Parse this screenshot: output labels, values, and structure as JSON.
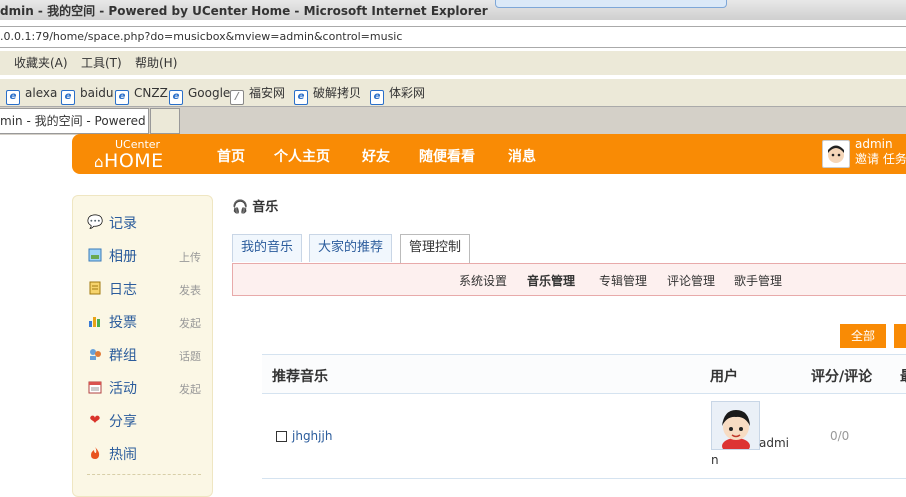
{
  "window": {
    "title": "dmin - 我的空间 - Powered by UCenter Home - Microsoft Internet Explorer",
    "address": ".0.0.1:79/home/space.php?do=musicbox&mview=admin&control=music"
  },
  "menu": [
    "收藏夹(A)",
    "工具(T)",
    "帮助(H)"
  ],
  "favorites": [
    "alexa",
    "baidu",
    "CNZZ",
    "Google",
    "福安网",
    "破解拷贝",
    "体彩网"
  ],
  "browser_tab": "min - 我的空间 - Powered ...",
  "site": {
    "logo_top": "UCenter",
    "logo_main": "HOME",
    "nav": [
      "首页",
      "个人主页",
      "好友",
      "随便看看",
      "消息"
    ],
    "user": "admin",
    "user_links": "邀请  任务"
  },
  "sidebar": {
    "items": [
      {
        "label": "记录",
        "sub": "",
        "icon": "chat-bubble-icon"
      },
      {
        "label": "相册",
        "sub": "上传",
        "icon": "photo-icon"
      },
      {
        "label": "日志",
        "sub": "发表",
        "icon": "notebook-icon"
      },
      {
        "label": "投票",
        "sub": "发起",
        "icon": "bar-chart-icon"
      },
      {
        "label": "群组",
        "sub": "话题",
        "icon": "group-icon"
      },
      {
        "label": "活动",
        "sub": "发起",
        "icon": "calendar-icon"
      },
      {
        "label": "分享",
        "sub": "",
        "icon": "heart-icon"
      },
      {
        "label": "热闹",
        "sub": "",
        "icon": "fire-icon"
      }
    ]
  },
  "content": {
    "title": "音乐",
    "tabs": [
      "我的音乐",
      "大家的推荐",
      "管理控制"
    ],
    "active_tab": "管理控制",
    "subnav": [
      "系统设置",
      "音乐管理",
      "专辑管理",
      "评论管理",
      "歌手管理"
    ],
    "active_subnav": "音乐管理",
    "filter_button": "全部",
    "table": {
      "headers": [
        "推荐音乐",
        "用户",
        "评分/评论",
        "最"
      ],
      "rows": [
        {
          "name": "jhghjjh",
          "user_part1": "admi",
          "user_part2": "n",
          "score": "0/0"
        }
      ]
    }
  },
  "colors": {
    "accent": "#f98b05",
    "link": "#2b5c9c",
    "subnav_bg": "#fdf0ef"
  }
}
